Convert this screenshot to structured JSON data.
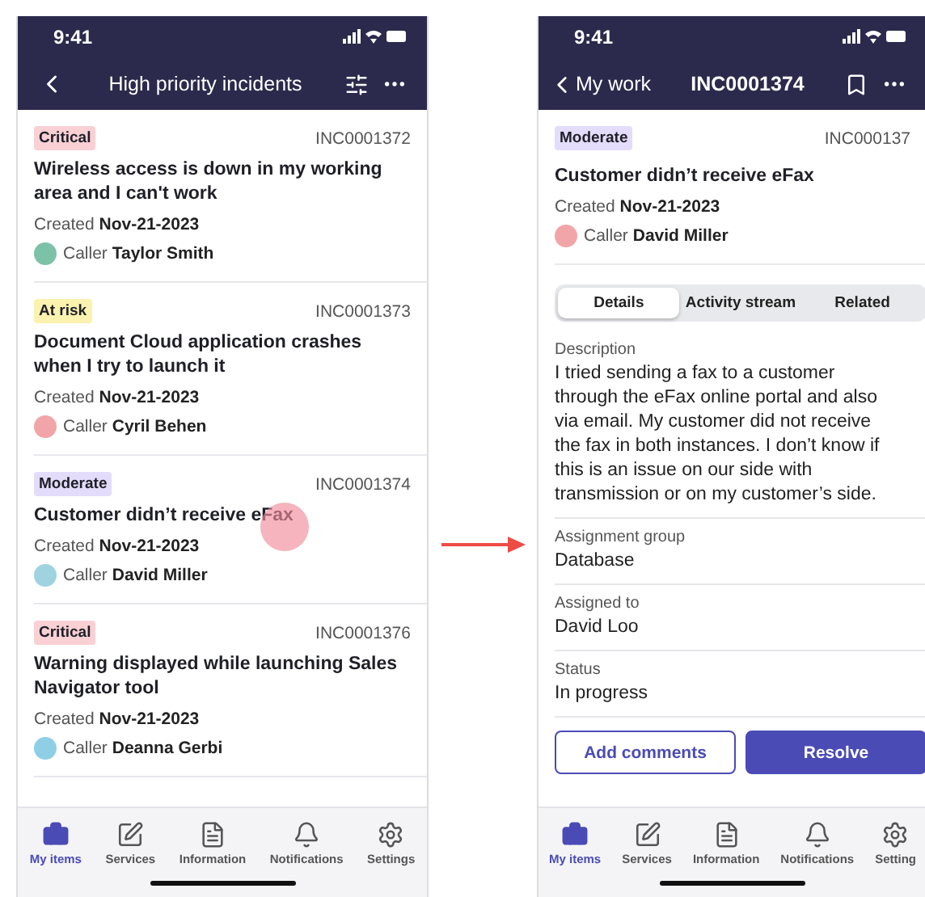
{
  "list_screen": {
    "status_time": "9:41",
    "title": "High priority incidents",
    "incidents": [
      {
        "priority": "Critical",
        "color": "#f9d0d4",
        "number": "INC0001372",
        "title": "Wireless access is down in my working area and I can't work",
        "created_label": "Created",
        "created_date": "Nov-21-2023",
        "caller_label": "Caller",
        "caller_name": "Taylor Smith",
        "tapped": false
      },
      {
        "priority": "At risk",
        "color": "#fbf2b0",
        "number": "INC0001373",
        "title": "Document Cloud application crashes when I try to launch it",
        "created_label": "Created",
        "created_date": "Nov-21-2023",
        "caller_label": "Caller",
        "caller_name": "Cyril Behen",
        "tapped": false
      },
      {
        "priority": "Moderate",
        "color": "#e3dcfa",
        "number": "INC0001374",
        "title": "Customer didn’t receive eFax",
        "created_label": "Created",
        "created_date": "Nov-21-2023",
        "caller_label": "Caller",
        "caller_name": "David Miller",
        "tapped": true
      },
      {
        "priority": "Critical",
        "color": "#f9d0d4",
        "number": "INC0001376",
        "title": "Warning displayed while launching Sales Navigator tool",
        "created_label": "Created",
        "created_date": "Nov-21-2023",
        "caller_label": "Caller",
        "caller_name": "Deanna Gerbi",
        "tapped": false
      }
    ],
    "tab_bar": [
      {
        "label": "My items",
        "selected": true
      },
      {
        "label": "Services",
        "selected": false
      },
      {
        "label": "Information",
        "selected": false
      },
      {
        "label": "Notifications",
        "selected": false
      },
      {
        "label": "Settings",
        "selected": false
      }
    ]
  },
  "detail_screen": {
    "status_time": "9:41",
    "back_label": "My work",
    "title": "INC0001374",
    "priority": "Moderate",
    "color": "#e3dcfa",
    "number": "INC000137",
    "incident_title": "Customer didn’t receive eFax",
    "created_label": "Created",
    "created_date": "Nov-21-2023",
    "caller_label": "Caller",
    "caller_name": "David Miller",
    "segments": [
      {
        "label": "Details",
        "selected": true
      },
      {
        "label": "Activity stream",
        "selected": false
      },
      {
        "label": "Related",
        "selected": false
      }
    ],
    "fields": [
      {
        "label": "Description",
        "value": "I tried sending a fax to a customer through the eFax online portal and also via email. My customer did not receive the fax in both instances. I don’t know if this is an issue on our side with transmission or on my customer’s side."
      },
      {
        "label": "Assignment group",
        "value": "Database"
      },
      {
        "label": "Assigned to",
        "value": "David Loo"
      },
      {
        "label": "Status",
        "value": "In progress"
      }
    ],
    "buttons": [
      {
        "label": "Add comments",
        "kind": "outline"
      },
      {
        "label": "Resolve",
        "kind": "primary"
      }
    ],
    "tab_bar": [
      {
        "label": "My items",
        "selected": true
      },
      {
        "label": "Services",
        "selected": false
      },
      {
        "label": "Information",
        "selected": false
      },
      {
        "label": "Notifications",
        "selected": false
      },
      {
        "label": "Setting",
        "selected": false
      }
    ]
  }
}
